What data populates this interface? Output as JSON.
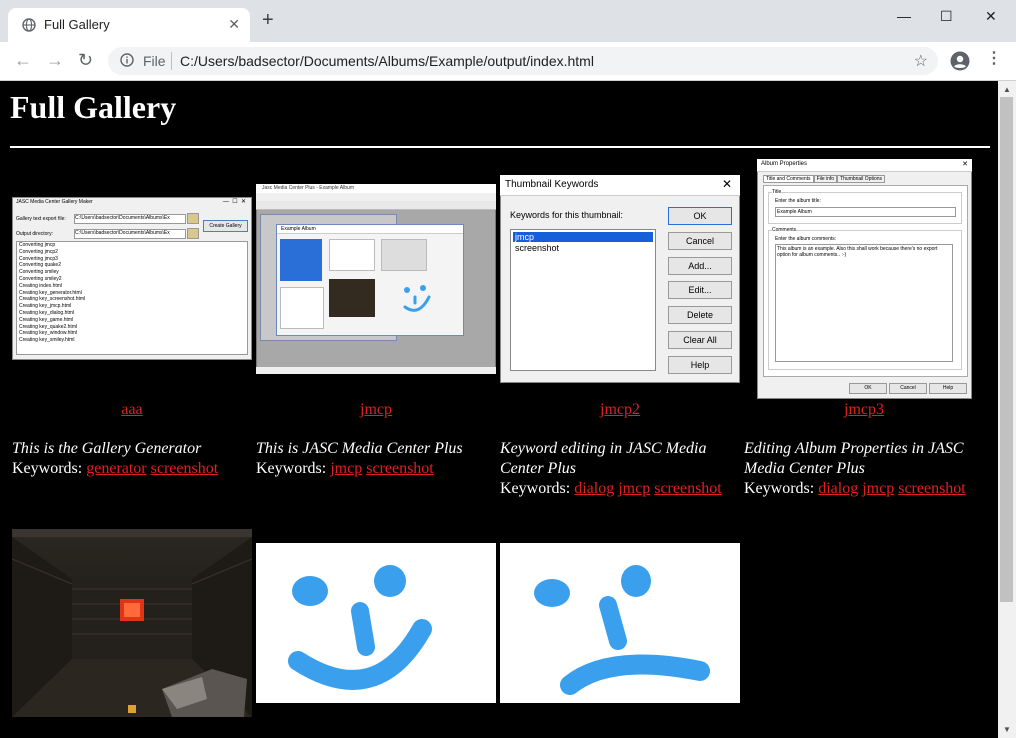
{
  "tab": {
    "title": "Full Gallery"
  },
  "address": {
    "file_label": "File",
    "url": "C:/Users/badsector/Documents/Albums/Example/output/index.html"
  },
  "page": {
    "title": "Full Gallery"
  },
  "items": [
    {
      "caption": "aaa",
      "description": "This is the Gallery Generator",
      "keywords_label": "Keywords:",
      "keywords": [
        "generator",
        "screenshot"
      ],
      "thumb": {
        "title": "JASC Media Center Gallery Maker",
        "field1_label": "Gallery text export file:",
        "field1_value": "C:\\Users\\badsector\\Documents\\Albums\\Ex",
        "field2_label": "Output directory:",
        "field2_value": "C:\\Users\\badsector\\Documents\\Albums\\Ex",
        "button": "Create Gallery",
        "log": [
          "Converting jmcp",
          "Converting jmcp2",
          "Converting jmcp3",
          "Converting quake2",
          "Converting smiley",
          "Converting smiley2",
          "Creating index.html",
          "Creating key_generator.html",
          "Creating key_screenshot.html",
          "Creating key_jmcp.html",
          "Creating key_dialog.html",
          "Creating key_game.html",
          "Creating key_quake2.html",
          "Creating key_window.html",
          "Creating key_smiley.html"
        ]
      }
    },
    {
      "caption": "jmcp",
      "description": "This is JASC Media Center Plus",
      "keywords_label": "Keywords:",
      "keywords": [
        "jmcp",
        "screenshot"
      ],
      "thumb": {
        "title": "Jasc Media Center Plus - Example Album",
        "inner_title": "Example Album"
      }
    },
    {
      "caption": "jmcp2",
      "description": "Keyword editing in JASC Media Center Plus",
      "keywords_label": "Keywords:",
      "keywords": [
        "dialog",
        "jmcp",
        "screenshot"
      ],
      "thumb": {
        "title": "Thumbnail Keywords",
        "list_label": "Keywords for this thumbnail:",
        "list_items": [
          "jmcp",
          "screenshot"
        ],
        "buttons": [
          "OK",
          "Cancel",
          "Add...",
          "Edit...",
          "Delete",
          "Clear All",
          "Help"
        ]
      }
    },
    {
      "caption": "jmcp3",
      "description": "Editing Album Properties in JASC Media Center Plus",
      "keywords_label": "Keywords:",
      "keywords": [
        "dialog",
        "jmcp",
        "screenshot"
      ],
      "thumb": {
        "title": "Album Properties",
        "tabs": [
          "Title and Comments",
          "File info",
          "Thumbnail Options"
        ],
        "title_group": "Title",
        "title_hint": "Enter the album title:",
        "title_value": "Example Album",
        "comments_group": "Comments",
        "comments_hint": "Enter the album comments:",
        "comments_value": "This album is an example. Also this shall work because there's no export option for album comments.. :-)",
        "buttons": [
          "OK",
          "Cancel",
          "Help"
        ]
      }
    }
  ],
  "row2": [
    {
      "kind": "game-screenshot"
    },
    {
      "kind": "smiley-happy"
    },
    {
      "kind": "smiley-sad"
    }
  ],
  "colors": {
    "link": "#e02020",
    "background": "#000000",
    "smiley": "#3aa0ee"
  }
}
